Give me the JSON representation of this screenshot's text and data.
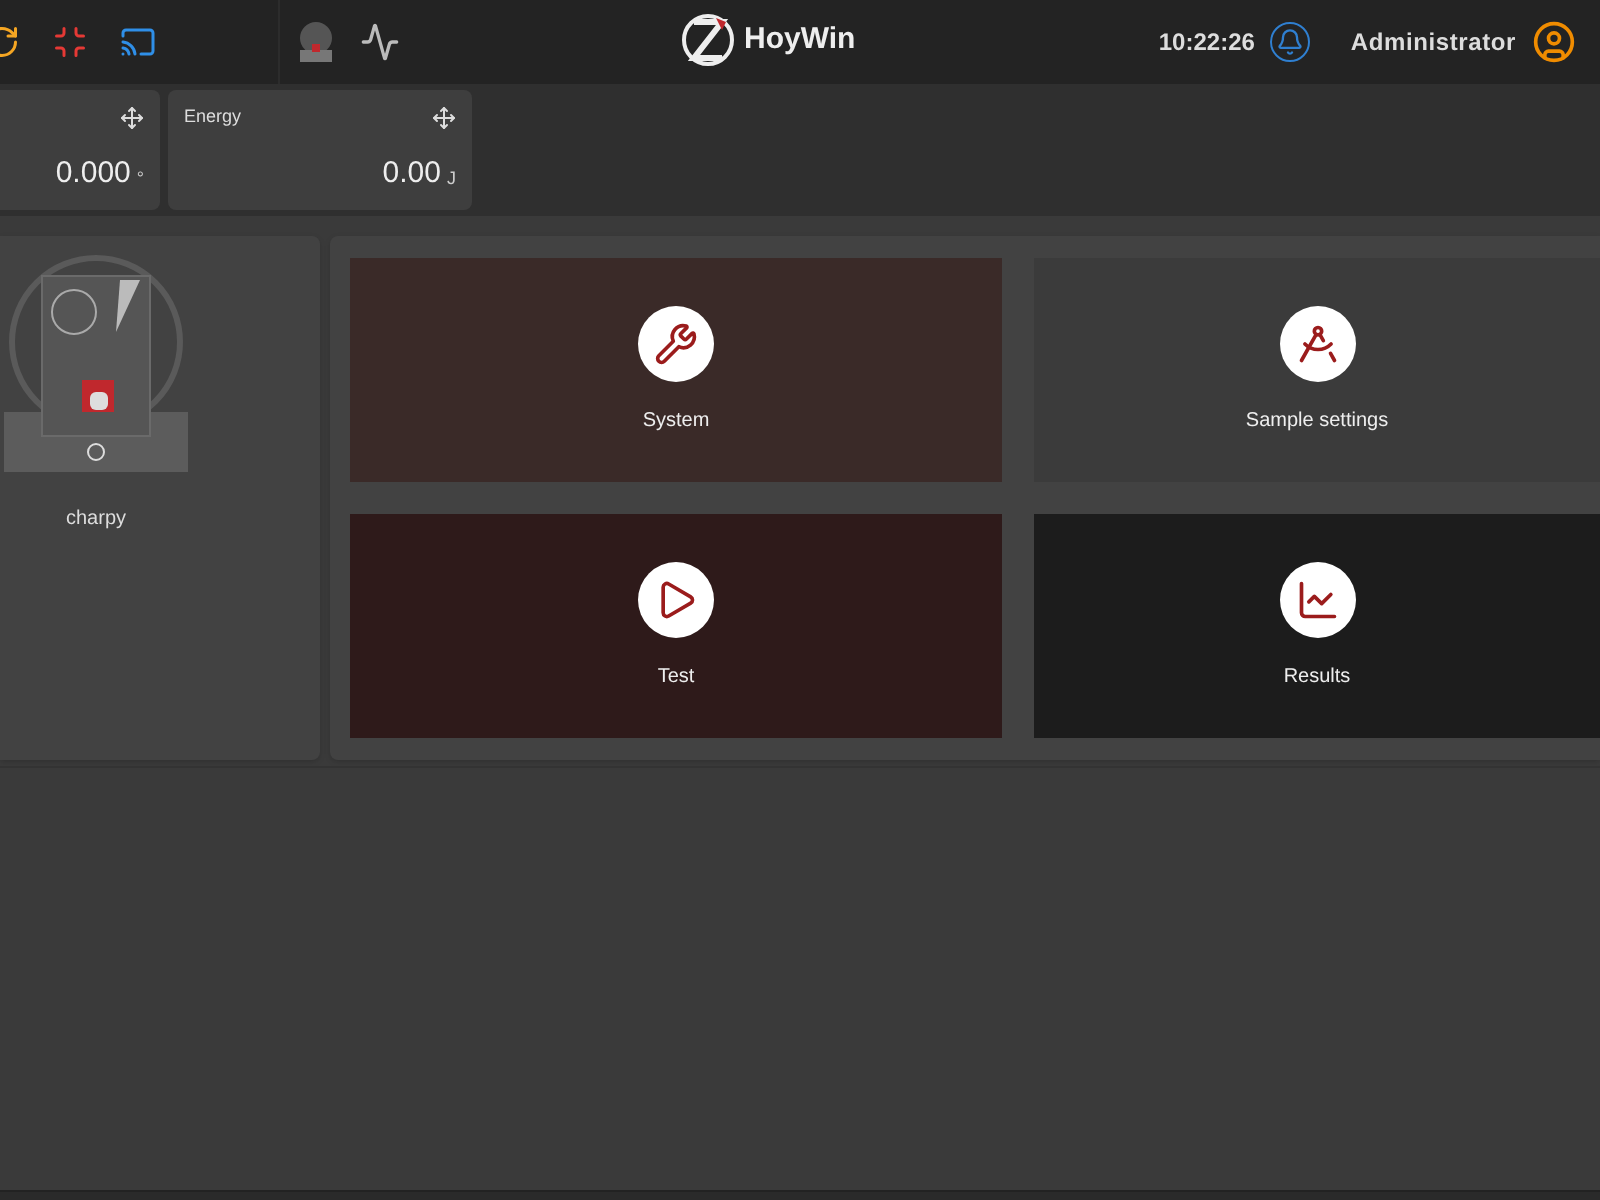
{
  "header": {
    "brand": "HoyWin",
    "time": "10:22:26",
    "user": "Administrator"
  },
  "widgets": [
    {
      "value": "0.000",
      "unit": "°"
    },
    {
      "label": "Energy",
      "value": "0.00",
      "unit": "J"
    }
  ],
  "machine": {
    "name": "charpy"
  },
  "tiles": [
    {
      "kind": "system",
      "label": "System"
    },
    {
      "kind": "sample",
      "label": "Sample settings"
    },
    {
      "kind": "test",
      "label": "Test"
    },
    {
      "kind": "results",
      "label": "Results"
    }
  ]
}
